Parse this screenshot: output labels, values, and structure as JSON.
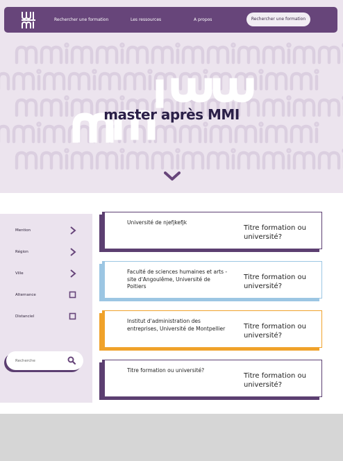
{
  "nav": {
    "links": [
      "Rechercher une formation",
      "Les ressources",
      "A propos"
    ],
    "cta": "Rechercher une formation"
  },
  "hero": {
    "title": "master après MMI"
  },
  "colors": {
    "brand": "#67457a",
    "hero_bg": "#ece4ee",
    "card_purple": "#5c3f71",
    "card_blue": "#9cc6e3",
    "card_orange": "#f0a22a"
  },
  "sidebar": {
    "filters": [
      {
        "label": "Mention",
        "control": "chevron-right-icon"
      },
      {
        "label": "Région",
        "control": "chevron-right-icon"
      },
      {
        "label": "Ville",
        "control": "chevron-right-icon"
      },
      {
        "label": "Alternance",
        "control": "checkbox"
      },
      {
        "label": "Distanciel",
        "control": "checkbox"
      }
    ],
    "search_placeholder": "Recherche"
  },
  "cards": [
    {
      "name": "Université de njefjkefjk",
      "title": "Titre formation ou université?",
      "accent": "#5c3f71"
    },
    {
      "name": "Faculté de sciences humaines et arts - site d'Angoulême, Université de Poitiers",
      "title": "Titre formation ou université?",
      "accent": "#9cc6e3"
    },
    {
      "name": "Institut d'administration des entreprises, Université de Montpellier",
      "title": "Titre formation ou université?",
      "accent": "#f0a22a"
    },
    {
      "name": "Titre formation ou université?",
      "title": "Titre formation ou université?",
      "accent": "#5c3f71"
    }
  ]
}
